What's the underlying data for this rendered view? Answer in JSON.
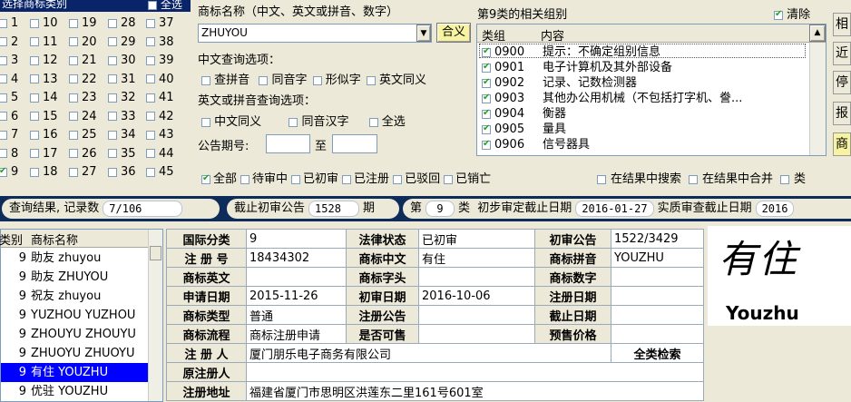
{
  "class_panel": {
    "header": "选择商标类别",
    "select_all": "全选",
    "col1": [
      "1",
      "2",
      "3",
      "4",
      "5",
      "6",
      "7",
      "8",
      "9"
    ],
    "col2": [
      "10",
      "11",
      "12",
      "13",
      "14",
      "15",
      "16",
      "17",
      "18"
    ],
    "col3": [
      "19",
      "20",
      "21",
      "22",
      "23",
      "24",
      "25",
      "26",
      "27"
    ],
    "col4": [
      "28",
      "29",
      "30",
      "31",
      "32",
      "33",
      "34",
      "35",
      "36"
    ],
    "col5": [
      "37",
      "38",
      "39",
      "40",
      "41",
      "42",
      "43",
      "44",
      "45"
    ],
    "checked": [
      "9"
    ]
  },
  "search": {
    "name_label": "商标名称（中文、英文或拼音、数字）",
    "name_value": "ZHUYOU",
    "match_button": "合义",
    "cn_options_label": "中文查询选项：",
    "cn_options": [
      "查拼音",
      "同音字",
      "形似字",
      "英文同义"
    ],
    "en_options_label": "英文或拼音查询选项：",
    "en_options": [
      "中文同义",
      "同音汉字",
      "全选"
    ],
    "period_label": "公告期号:",
    "period_to": "至"
  },
  "groups": {
    "title": "第9类的相关组别",
    "clear_label": "清除",
    "col_group": "类组",
    "col_content": "内容",
    "rows": [
      {
        "code": "0900",
        "text": "提示：不确定组别信息"
      },
      {
        "code": "0901",
        "text": "电子计算机及其外部设备"
      },
      {
        "code": "0902",
        "text": "记录、记数检测器"
      },
      {
        "code": "0903",
        "text": "其他办公用机械（不包括打字机、誊..."
      },
      {
        "code": "0904",
        "text": "衡器"
      },
      {
        "code": "0905",
        "text": "量具"
      },
      {
        "code": "0906",
        "text": "信号器具"
      }
    ]
  },
  "side_buttons": [
    "相",
    "近",
    "停",
    "报",
    "商"
  ],
  "status_filters": [
    "全部",
    "待审中",
    "已初审",
    "已注册",
    "已驳回",
    "已销亡"
  ],
  "result_filters": [
    "在结果中搜索",
    "在结果中合并",
    "类"
  ],
  "result_bar": {
    "records_label": "查询结果, 记录数",
    "records_value": "7/106",
    "deadline_label": "截止初审公告",
    "deadline_value": "1528",
    "deadline_unit": "期",
    "class_label": "第",
    "class_value": "9",
    "class_unit": "类",
    "prelim_label": "初步审定截止日期",
    "prelim_value": "2016-01-27",
    "exam_label": "实质审查截止日期",
    "exam_value": "2016"
  },
  "result_list": {
    "col_class": "类别",
    "col_name": "商标名称",
    "rows": [
      {
        "cls": "9",
        "name": "助友 zhuyou"
      },
      {
        "cls": "9",
        "name": "助友 ZHUYOU"
      },
      {
        "cls": "9",
        "name": "祝友 zhuyou"
      },
      {
        "cls": "9",
        "name": "YUZHOU YUZHOU"
      },
      {
        "cls": "9",
        "name": "ZHOUYU ZHOUYU"
      },
      {
        "cls": "9",
        "name": "ZHUOYU ZHUOYU"
      },
      {
        "cls": "9",
        "name": "有住 YOUZHU"
      },
      {
        "cls": "9",
        "name": "优驻 YOUZHU"
      }
    ],
    "selected_index": 6
  },
  "detail": {
    "intl_class_label": "国际分类",
    "intl_class": "9",
    "legal_status_label": "法律状态",
    "legal_status": "已初审",
    "prelim_pub_label": "初审公告",
    "prelim_pub": "1522/3429",
    "reg_no_label": "注 册 号",
    "reg_no": "18434302",
    "cn_label": "商标中文",
    "cn": "有住",
    "pinyin_label": "商标拼音",
    "pinyin": "YOUZHU",
    "en_label": "商标英文",
    "en": "",
    "initial_label": "商标字头",
    "initial": "",
    "digit_label": "商标数字",
    "digit": "",
    "apply_date_label": "申请日期",
    "apply_date": "2015-11-26",
    "prelim_date_label": "初审日期",
    "prelim_date": "2016-10-06",
    "reg_date_label": "注册日期",
    "reg_date": "",
    "type_label": "商标类型",
    "type": "普通",
    "reg_pub_label": "注册公告",
    "reg_pub": "",
    "expire_label": "截止日期",
    "expire": "",
    "process_label": "商标流程",
    "process": "商标注册申请\u0000",
    "saleable_label": "是否可售",
    "saleable": "",
    "presale_label": "预售价格",
    "presale": "",
    "registrant_label": "注 册 人",
    "registrant": "厦门朋乐电子商务有限公司",
    "all_search": "全类检索",
    "orig_registrant_label": "原注册人",
    "orig_registrant": "",
    "address_label": "注册地址",
    "address": "福建省厦门市思明区洪莲东二里161号601室"
  },
  "logo": {
    "chinese": "有住",
    "english": "Youzhu"
  }
}
